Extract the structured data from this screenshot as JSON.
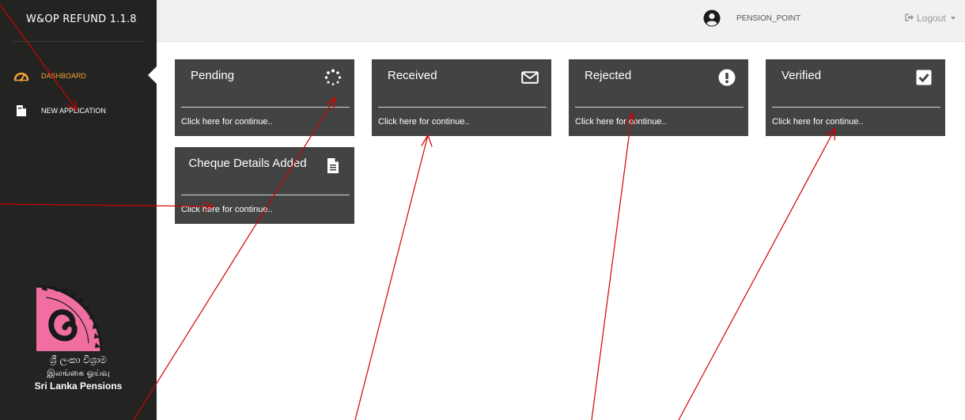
{
  "app": {
    "title": "W&OP REFUND 1.1.8"
  },
  "sidebar": {
    "items": [
      {
        "label": "DASHBOARD",
        "icon": "dashboard-icon",
        "active": true
      },
      {
        "label": "NEW APPLICATION",
        "icon": "document-icon",
        "active": false
      }
    ],
    "logo": {
      "line1": "ශ්‍රී ලංකා විශ්‍රාම",
      "line2": "இலங்கை ஓய்வு",
      "line3": "Sri Lanka Pensions"
    }
  },
  "header": {
    "user": "PENSION_POINT",
    "logout_label": "Logout"
  },
  "cards": {
    "pending": {
      "title": "Pending",
      "footer": "Click here for continue..",
      "icon": "spinner-icon"
    },
    "received": {
      "title": "Received",
      "footer": "Click here for continue..",
      "icon": "envelope-icon"
    },
    "rejected": {
      "title": "Rejected",
      "footer": "Click here for continue..",
      "icon": "exclamation-icon"
    },
    "verified": {
      "title": "Verified",
      "footer": "Click here for continue..",
      "icon": "checkbox-icon"
    },
    "cheque": {
      "title": "Cheque Details Added",
      "footer": "Click here for continue..",
      "icon": "file-icon"
    }
  },
  "colors": {
    "sidebar_bg": "#232321",
    "card_bg": "#414443",
    "accent": "#f0a23a",
    "annotation": "#d40000"
  }
}
